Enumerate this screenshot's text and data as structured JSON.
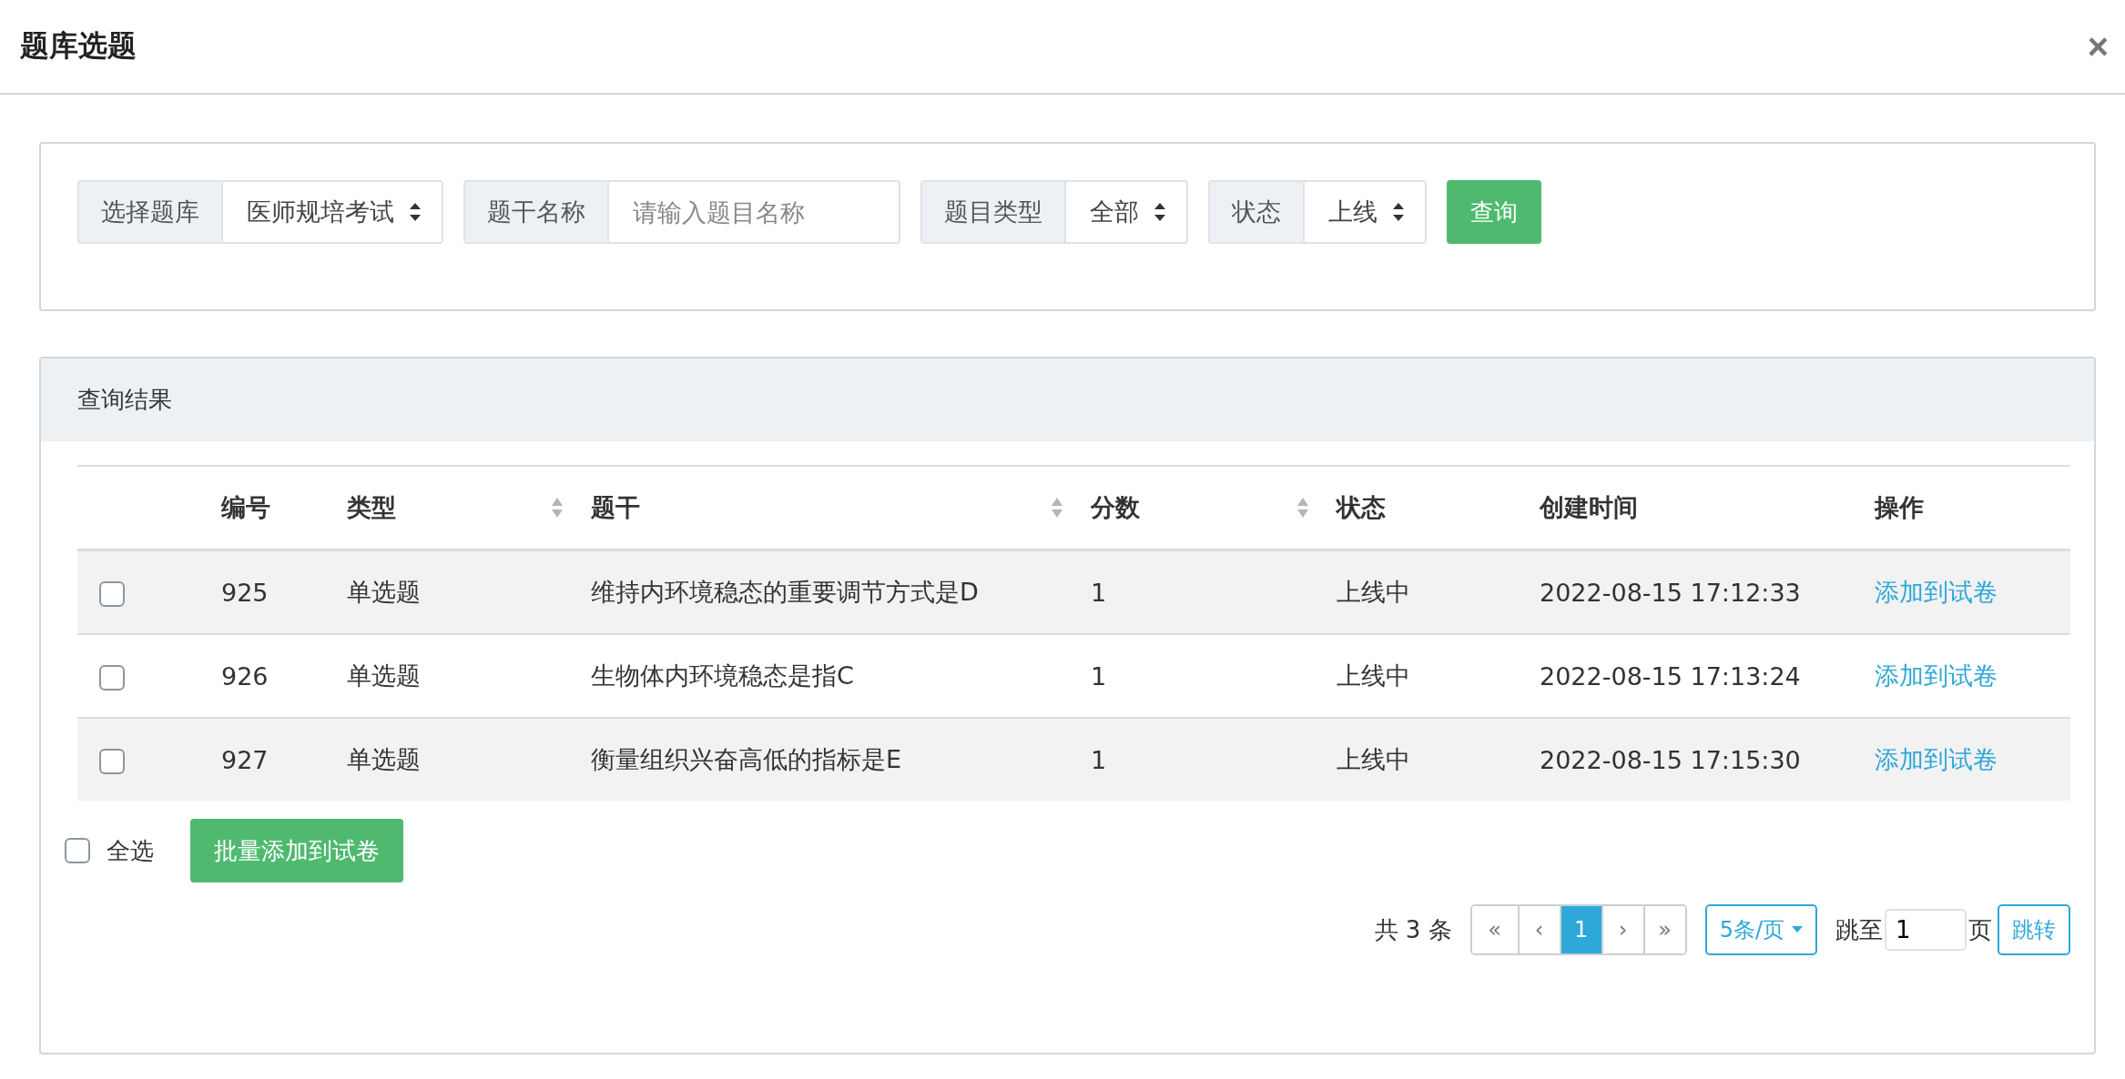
{
  "dialog": {
    "title": "题库选题",
    "close": "×"
  },
  "filters": [
    {
      "label": "选择题库",
      "kind": "select",
      "value": "医师规培考试"
    },
    {
      "label": "题干名称",
      "kind": "input",
      "placeholder": "请输入题目名称"
    },
    {
      "label": "题目类型",
      "kind": "select",
      "value": "全部"
    },
    {
      "label": "状态",
      "kind": "select",
      "value": "上线"
    }
  ],
  "query_button": "查询",
  "results": {
    "title": "查询结果",
    "columns": [
      {
        "label": "编号",
        "sortable": false
      },
      {
        "label": "类型",
        "sortable": true
      },
      {
        "label": "题干",
        "sortable": true
      },
      {
        "label": "分数",
        "sortable": true
      },
      {
        "label": "状态",
        "sortable": false
      },
      {
        "label": "创建时间",
        "sortable": false
      },
      {
        "label": "操作",
        "sortable": false
      }
    ],
    "rows": [
      {
        "checked": false,
        "id": "925",
        "type": "单选题",
        "stem": "维持内环境稳态的重要调节方式是D",
        "score": "1",
        "status": "上线中",
        "created": "2022-08-15 17:12:33",
        "action": "添加到试卷"
      },
      {
        "checked": false,
        "id": "926",
        "type": "单选题",
        "stem": "生物体内环境稳态是指C",
        "score": "1",
        "status": "上线中",
        "created": "2022-08-15 17:13:24",
        "action": "添加到试卷"
      },
      {
        "checked": false,
        "id": "927",
        "type": "单选题",
        "stem": "衡量组织兴奋高低的指标是E",
        "score": "1",
        "status": "上线中",
        "created": "2022-08-15 17:15:30",
        "action": "添加到试卷"
      }
    ],
    "select_all": {
      "label": "全选",
      "checked": false
    },
    "batch_button": "批量添加到试卷"
  },
  "pagination": {
    "total": "共 3 条",
    "pages": [
      {
        "label": "«",
        "selected": false
      },
      {
        "label": "‹",
        "selected": false
      },
      {
        "label": "1",
        "selected": true
      },
      {
        "label": "›",
        "selected": false
      },
      {
        "label": "»",
        "selected": false
      }
    ],
    "page_size": "5条/页",
    "jump_label": "跳至",
    "jump_value": "1",
    "page_unit": "页",
    "jump_button": "跳转"
  }
}
